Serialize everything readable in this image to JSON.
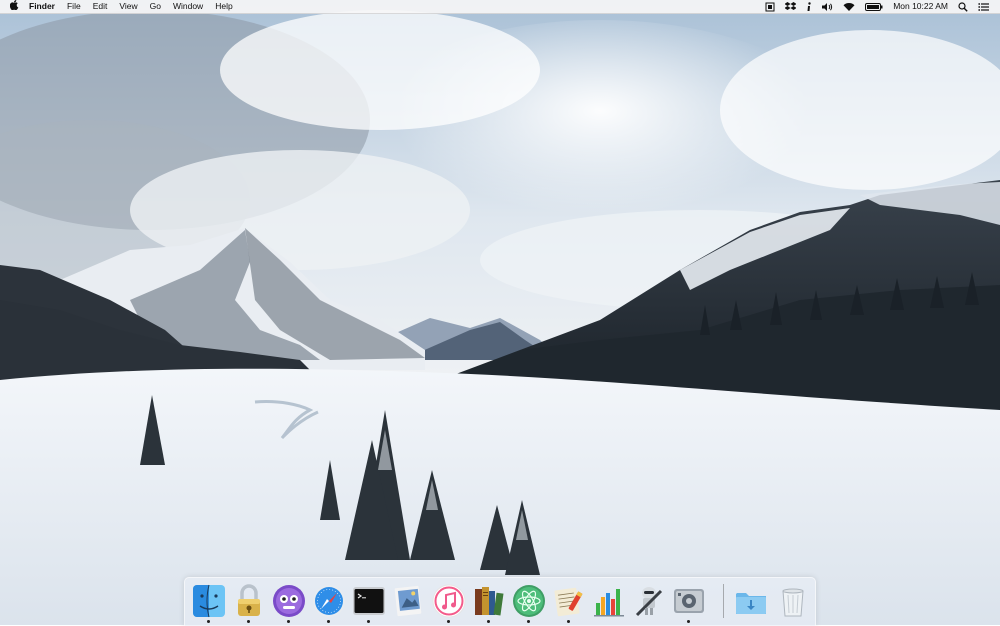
{
  "menubar": {
    "apple_icon": "apple-icon",
    "app_name": "Finder",
    "menus": [
      "File",
      "Edit",
      "View",
      "Go",
      "Window",
      "Help"
    ],
    "status_icons": [
      "screenshot-icon",
      "dropbox-icon",
      "info-icon",
      "volume-icon",
      "wifi-icon",
      "battery-icon"
    ],
    "clock": "Mon 10:22 AM",
    "search_icon": "spotlight-search-icon",
    "notification_icon": "notification-center-icon"
  },
  "dock": {
    "apps": [
      {
        "name": "Finder",
        "icon": "finder-icon",
        "running": true
      },
      {
        "name": "Keychain Access",
        "icon": "keychain-lock-icon",
        "running": true
      },
      {
        "name": "Tweetbot",
        "icon": "tweetbot-icon",
        "running": true
      },
      {
        "name": "Safari",
        "icon": "safari-compass-icon",
        "running": true
      },
      {
        "name": "Terminal",
        "icon": "terminal-icon",
        "running": true
      },
      {
        "name": "Preview",
        "icon": "preview-icon",
        "running": false
      },
      {
        "name": "iTunes",
        "icon": "itunes-music-icon",
        "running": true
      },
      {
        "name": "Calibre",
        "icon": "calibre-books-icon",
        "running": true
      },
      {
        "name": "Atom",
        "icon": "atom-icon",
        "running": true
      },
      {
        "name": "Script Editor",
        "icon": "script-editor-icon",
        "running": true
      },
      {
        "name": "Numbers",
        "icon": "numbers-chart-icon",
        "running": false
      },
      {
        "name": "Automator",
        "icon": "automator-robot-icon",
        "running": false
      },
      {
        "name": "System Information",
        "icon": "system-info-icon",
        "running": true
      }
    ],
    "stacks": [
      {
        "name": "Downloads",
        "icon": "downloads-folder-icon"
      },
      {
        "name": "Trash",
        "icon": "trash-icon"
      }
    ]
  },
  "colors": {
    "sky": "#dfe6ee",
    "snow": "#eef2f7",
    "mountain_dark": "#2a3038",
    "forest": "#1f272e",
    "dock_bg": "#e6ecf4"
  }
}
